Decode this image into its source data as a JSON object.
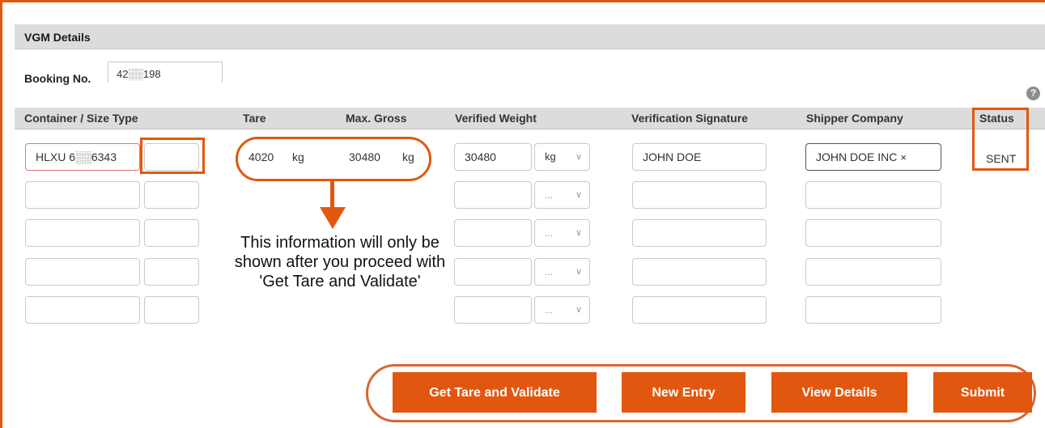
{
  "section_title": "VGM Details",
  "booking": {
    "label": "Booking No.",
    "value": "42░░198"
  },
  "help_icon": "?",
  "table": {
    "headers": {
      "container": "Container / Size Type",
      "tare": "Tare",
      "max_gross": "Max. Gross",
      "verified_weight": "Verified Weight",
      "verification_signature": "Verification Signature",
      "shipper_company": "Shipper Company",
      "status": "Status"
    },
    "row1": {
      "container": "HLXU 6░░6343",
      "size_type": "",
      "tare_value": "4020",
      "tare_unit": "kg",
      "max_gross_value": "30480",
      "max_gross_unit": "kg",
      "verified_weight": "30480",
      "unit": "kg",
      "signature": "JOHN DOE",
      "shipper": "JOHN DOE INC",
      "shipper_clear": "×",
      "status": "SENT"
    },
    "empty_unit_placeholder": "...",
    "caret": "∨"
  },
  "annotation": "This information will only be shown after you proceed with 'Get Tare and Validate'",
  "buttons": {
    "get_tare": "Get Tare and Validate",
    "new_entry": "New Entry",
    "view_details": "View Details",
    "submit": "Submit"
  },
  "colors": {
    "accent": "#e2570f",
    "header_bg": "#dcdcdc",
    "error_border": "#e8717a"
  }
}
